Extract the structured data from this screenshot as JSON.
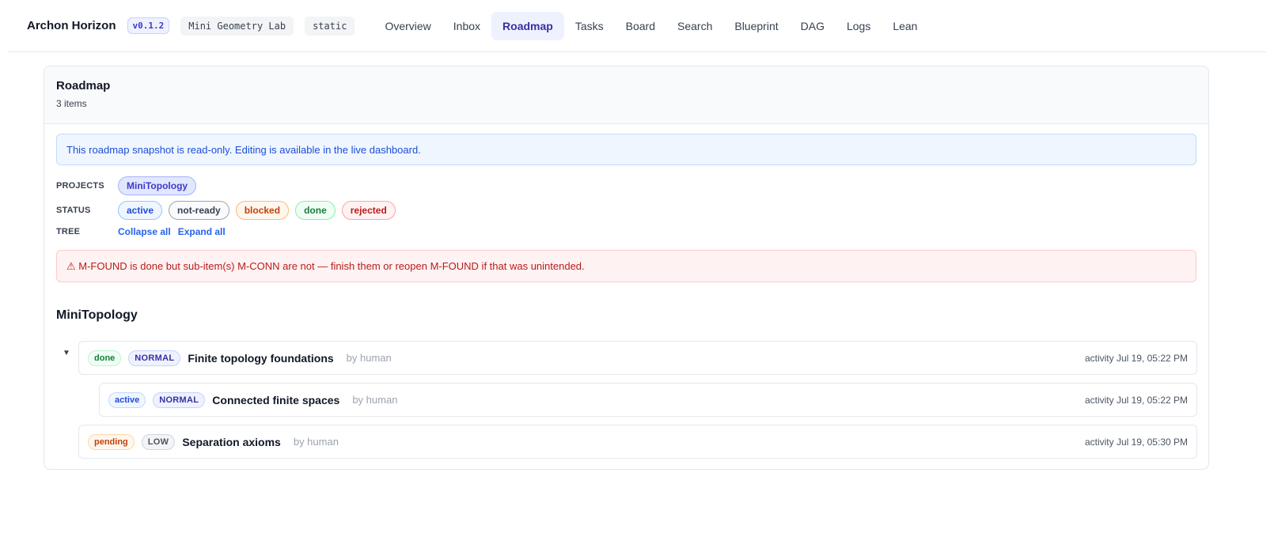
{
  "header": {
    "brand": "Archon Horizon",
    "version": "v0.1.2",
    "workspace": "Mini Geometry Lab",
    "mode": "static",
    "tabs": [
      {
        "label": "Overview"
      },
      {
        "label": "Inbox"
      },
      {
        "label": "Roadmap",
        "active": true
      },
      {
        "label": "Tasks"
      },
      {
        "label": "Board"
      },
      {
        "label": "Search"
      },
      {
        "label": "Blueprint"
      },
      {
        "label": "DAG"
      },
      {
        "label": "Logs"
      },
      {
        "label": "Lean"
      }
    ]
  },
  "roadmap": {
    "title": "Roadmap",
    "count": "3 items",
    "notice": "This roadmap snapshot is read-only. Editing is available in the live dashboard.",
    "filters": {
      "projects_label": "PROJECTS",
      "projects": [
        "MiniTopology"
      ],
      "status_label": "STATUS",
      "statuses": [
        "active",
        "not-ready",
        "blocked",
        "done",
        "rejected"
      ],
      "tree_label": "TREE",
      "collapse_all": "Collapse all",
      "expand_all": "Expand all"
    },
    "warning": "⚠ M-FOUND is done but sub-item(s) M-CONN are not — finish them or reopen M-FOUND if that was unintended.",
    "group": {
      "title": "MiniTopology",
      "caret": "▼",
      "items": [
        {
          "status": "done",
          "priority": "NORMAL",
          "title": "Finite topology foundations",
          "by": "by human",
          "activity": "activity Jul 19, 05:22 PM"
        },
        {
          "status": "active",
          "priority": "NORMAL",
          "title": "Connected finite spaces",
          "by": "by human",
          "activity": "activity Jul 19, 05:22 PM"
        },
        {
          "status": "pending",
          "priority": "LOW",
          "title": "Separation axioms",
          "by": "by human",
          "activity": "activity Jul 19, 05:30 PM"
        }
      ]
    }
  }
}
